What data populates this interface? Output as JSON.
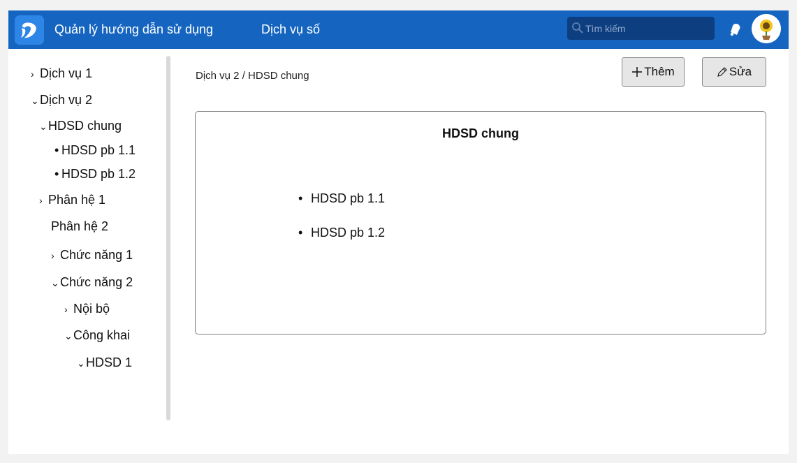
{
  "header": {
    "nav": [
      "Quản lý hướng dẫn sử dụng",
      "Dịch vụ số"
    ],
    "search_placeholder": "Tìm kiếm",
    "brand_color": "#1565c0"
  },
  "sidebar": {
    "items": [
      {
        "label": "Dịch vụ 1",
        "marker": "›"
      },
      {
        "label": "Dịch vụ 2",
        "marker": "⌄"
      },
      {
        "label": "HDSD chung",
        "marker": "⌄"
      },
      {
        "label": "HDSD pb 1.1",
        "marker": "•"
      },
      {
        "label": "HDSD pb 1.2",
        "marker": "•"
      },
      {
        "label": "Phân hệ 1",
        "marker": "›"
      },
      {
        "label": "Phân hệ 2",
        "marker": ""
      },
      {
        "label": "Chức năng 1",
        "marker": "›"
      },
      {
        "label": "Chức năng 2",
        "marker": "⌄"
      },
      {
        "label": "Nội bộ",
        "marker": "›"
      },
      {
        "label": "Công khai",
        "marker": "⌄"
      },
      {
        "label": "HDSD 1",
        "marker": "⌄"
      }
    ]
  },
  "main": {
    "breadcrumb": "Dịch vụ 2 / HDSD chung",
    "add_label": "Thêm",
    "edit_label": "Sửa",
    "card": {
      "title": "HDSD chung",
      "items": [
        "HDSD pb 1.1",
        "HDSD pb 1.2"
      ]
    }
  }
}
